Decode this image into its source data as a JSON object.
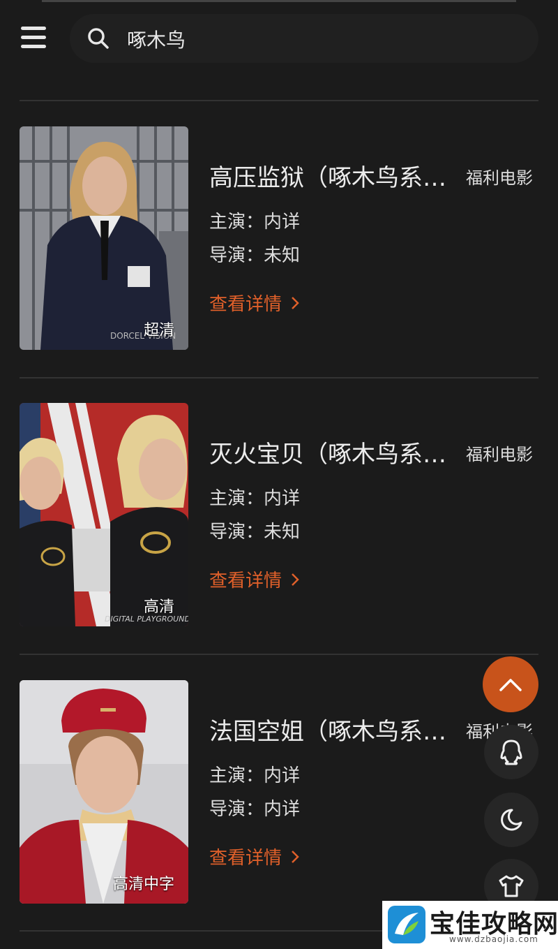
{
  "search": {
    "query": "啄木鸟"
  },
  "items": [
    {
      "title": "高压监狱（啄木鸟系列）",
      "category": "福利电影",
      "actor": "主演：内详",
      "director": "导演：未知",
      "detail": "查看详情",
      "quality": "超清",
      "poster_logo": "DORCEL VISION"
    },
    {
      "title": "灭火宝贝（啄木鸟系列）",
      "category": "福利电影",
      "actor": "主演：内详",
      "director": "导演：未知",
      "detail": "查看详情",
      "quality": "高清",
      "poster_logo": "DIGITAL PLAYGROUND"
    },
    {
      "title": "法国空姐（啄木鸟系列）",
      "category": "福利电影",
      "actor": "主演：内详",
      "director": "导演：内详",
      "detail": "查看详情",
      "quality": "高清中字",
      "poster_logo": ""
    }
  ],
  "fabs": [
    "back-to-top",
    "qq",
    "dark-mode",
    "theme"
  ],
  "watermark": {
    "title": "宝佳攻略网",
    "url": "www.dzbaojia.com"
  },
  "colors": {
    "accent": "#e0602a",
    "fab": "#c8531b",
    "background": "#1b1b1b"
  }
}
